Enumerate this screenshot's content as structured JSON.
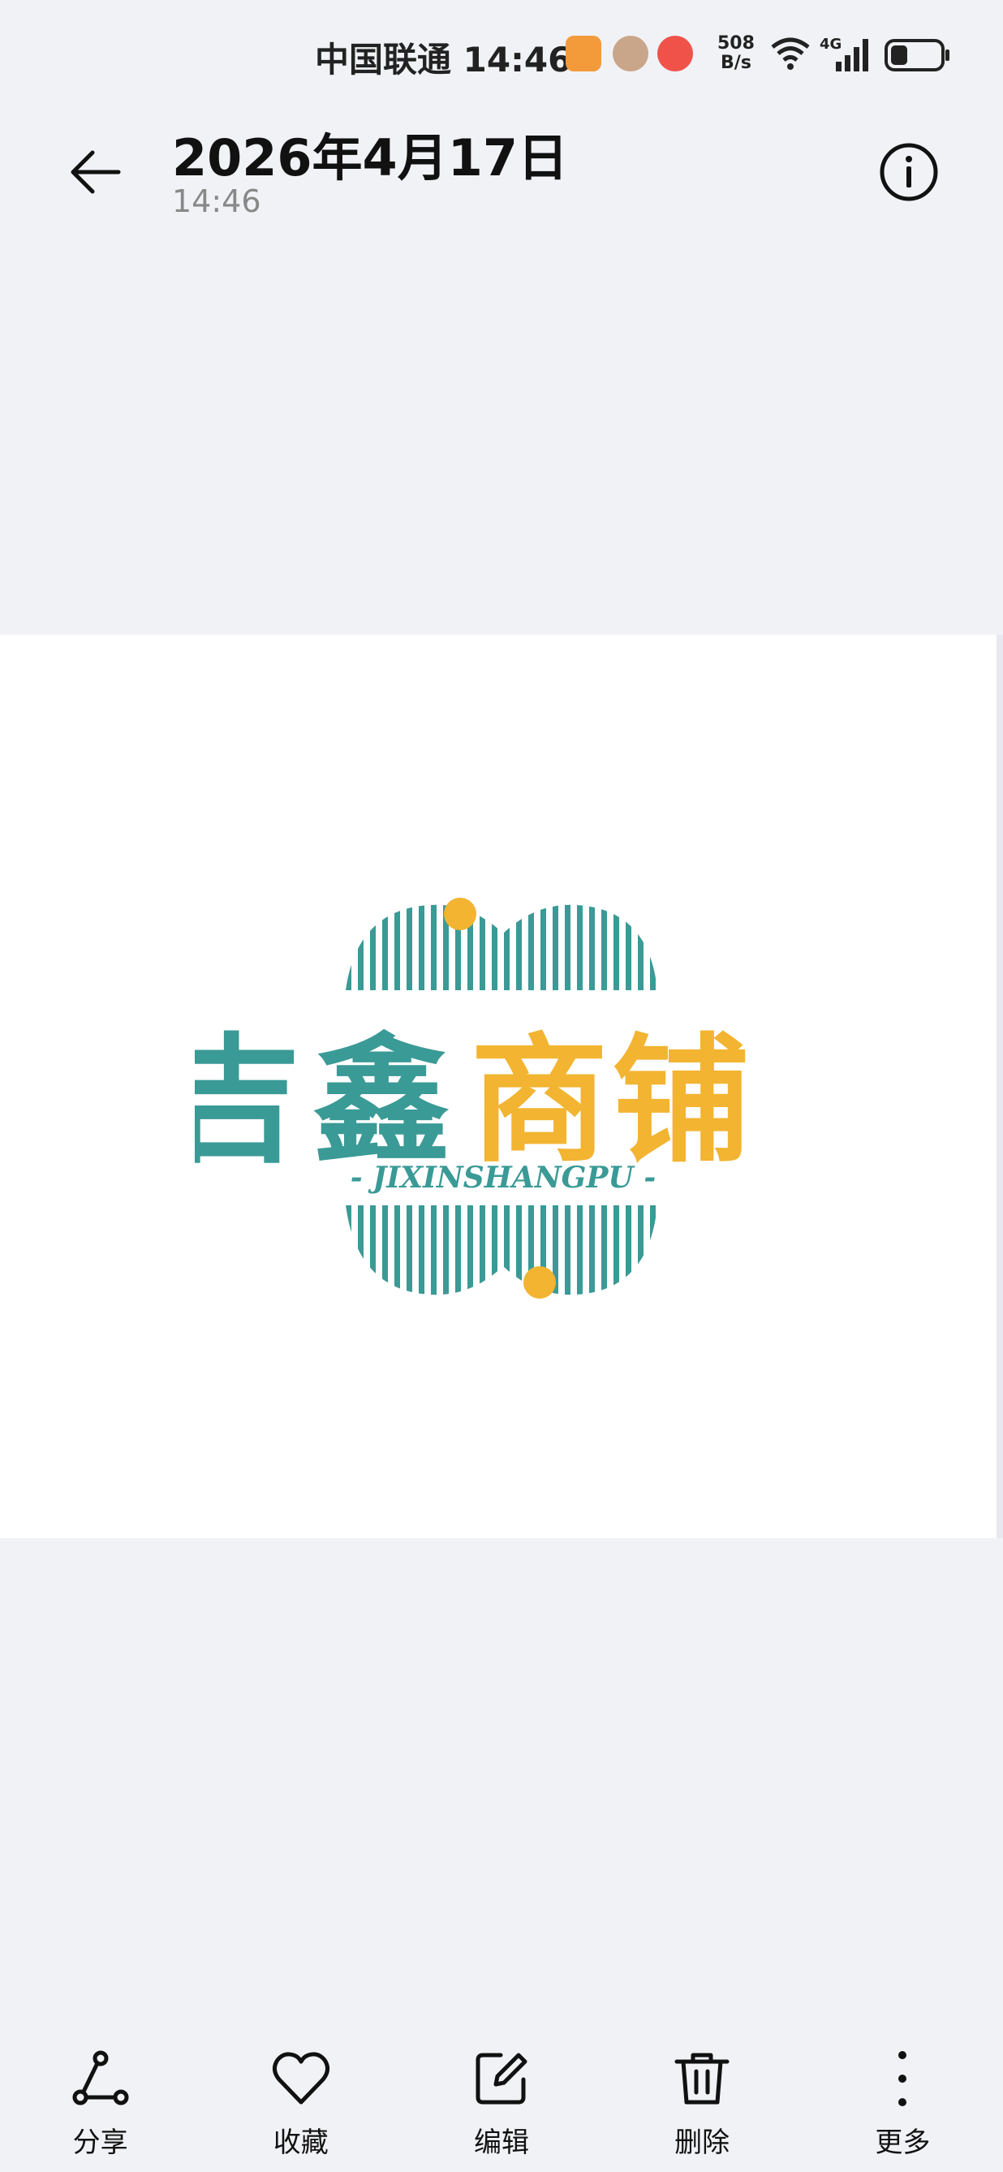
{
  "status_bar": {
    "carrier_time": "中国联通 14:46",
    "net_speed_value": "508",
    "net_speed_unit": "B/s",
    "network": "4G"
  },
  "header": {
    "date": "2026年4月17日",
    "time": "14:46"
  },
  "logo": {
    "chinese_left": "吉鑫",
    "chinese_right": "商铺",
    "pinyin": "- JIXINSHANGPU -",
    "colors": {
      "teal": "#3a9a96",
      "gold": "#f2b431"
    }
  },
  "toolbar": {
    "items": [
      {
        "label": "分享",
        "icon": "share-icon"
      },
      {
        "label": "收藏",
        "icon": "heart-icon"
      },
      {
        "label": "编辑",
        "icon": "edit-icon"
      },
      {
        "label": "删除",
        "icon": "trash-icon"
      },
      {
        "label": "更多",
        "icon": "more-icon"
      }
    ]
  }
}
